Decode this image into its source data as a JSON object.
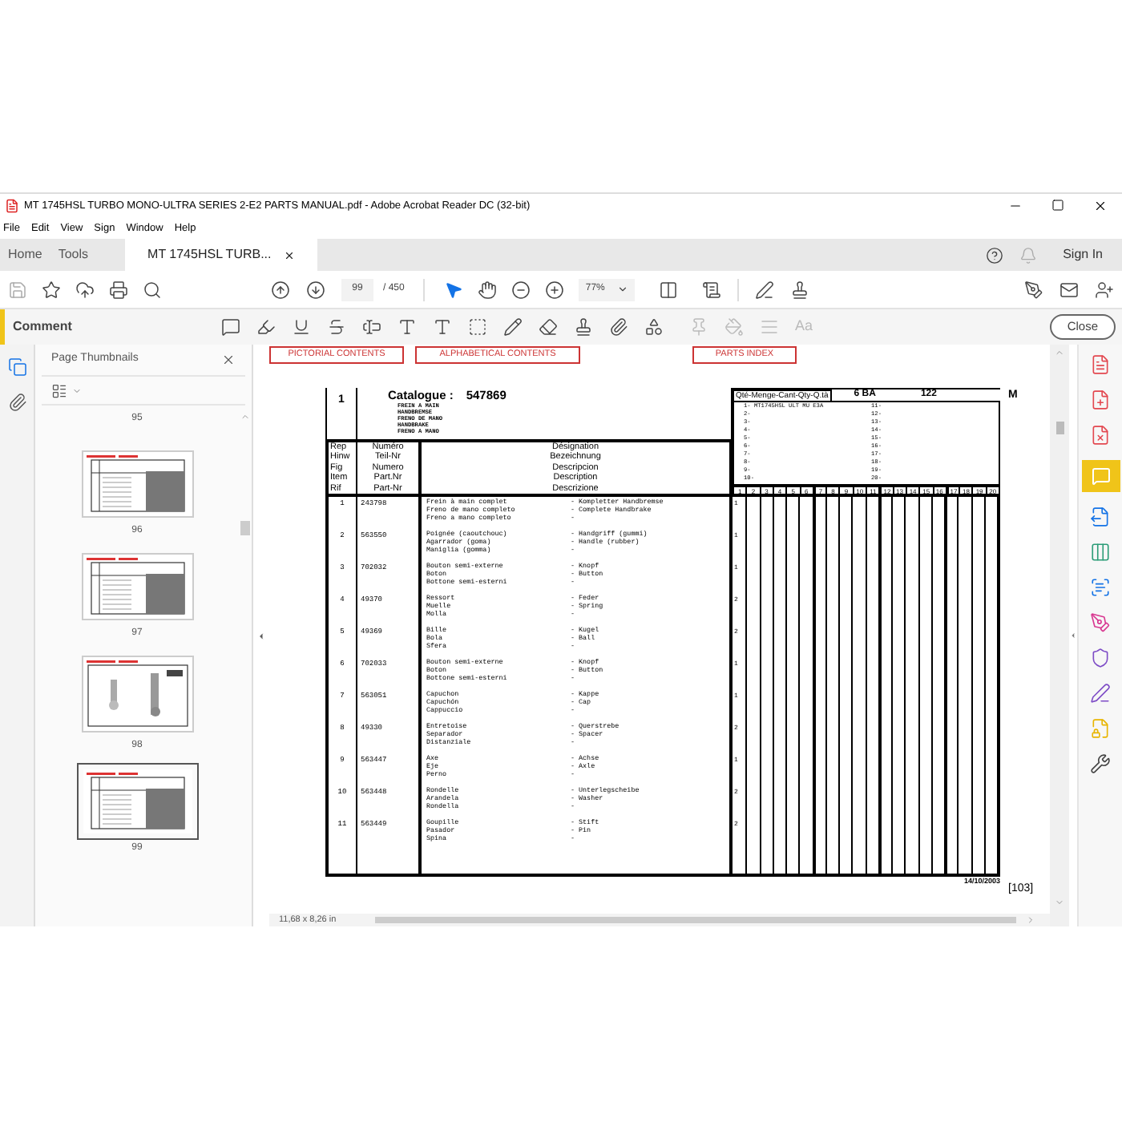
{
  "window": {
    "title": "MT 1745HSL TURBO MONO-ULTRA SERIES 2-E2 PARTS MANUAL.pdf - Adobe Acrobat Reader DC (32-bit)"
  },
  "menu": [
    "File",
    "Edit",
    "View",
    "Sign",
    "Window",
    "Help"
  ],
  "tabs": [
    {
      "label": "Home",
      "selected": false
    },
    {
      "label": "Tools",
      "selected": false
    },
    {
      "label": "MT 1745HSL TURB...",
      "selected": true
    }
  ],
  "sign_in": "Sign In",
  "toolbar": {
    "page": "99",
    "page_count": "/ 450",
    "zoom": "77%"
  },
  "comment_bar": {
    "label": "Comment",
    "font_tool": "Aa",
    "close": "Close"
  },
  "thumbnails": {
    "title": "Page Thumbnails",
    "first_label": "95",
    "pages": [
      {
        "label": "96",
        "kind": "table",
        "selected": false
      },
      {
        "label": "97",
        "kind": "table",
        "selected": false
      },
      {
        "label": "98",
        "kind": "diagram",
        "selected": false
      },
      {
        "label": "99",
        "kind": "table",
        "selected": true
      }
    ]
  },
  "document": {
    "links": [
      "PICTORIAL CONTENTS",
      "ALPHABETICAL CONTENTS",
      "PARTS INDEX"
    ],
    "group": "1",
    "catalogue_label": "Catalogue :",
    "catalogue_number": "547869",
    "titles": [
      "FREIN A MAIN",
      "HANDBREMSE",
      "FRENO DE MANO",
      "HANDBRAKE",
      "FRENO A MANO"
    ],
    "qty_header": "Qté-Menge-Cant-Qty-Q.tà",
    "code": "6 BA",
    "number": "122",
    "mark": "M",
    "models": [
      "1- MT1745HSL ULT MU E3A",
      "2-",
      "3-",
      "4-",
      "5-",
      "6-",
      "7-",
      "8-",
      "9-",
      "10-",
      "11-",
      "12-",
      "13-",
      "14-",
      "15-",
      "16-",
      "17-",
      "18-",
      "19-",
      "20-"
    ],
    "head_rep": [
      "Rep",
      "Hinw",
      "Fig",
      "Item",
      "Rif"
    ],
    "head_number": [
      "Numéro",
      "Teil-Nr",
      "Numero",
      "Part.Nr",
      "Part-Nr"
    ],
    "head_designation": [
      "Désignation",
      "Bezeichnung",
      "Descripcion",
      "Description",
      "Descrizione"
    ],
    "columns": [
      "1",
      "2",
      "3",
      "4",
      "5",
      "6",
      "7",
      "8",
      "9",
      "10",
      "11",
      "12",
      "13",
      "14",
      "15",
      "16",
      "17",
      "18",
      "19",
      "20"
    ],
    "rows": [
      {
        "item": "1",
        "part": "243798",
        "names": [
          "Frein à main complet",
          "Freno de mano completo",
          "Freno a mano completo"
        ],
        "translations": [
          "- Kompletter Handbremse",
          "- Complete Handbrake",
          "-"
        ],
        "qty": "1"
      },
      {
        "item": "2",
        "part": "563550",
        "names": [
          "Poignée (caoutchouc)",
          "Agarrador (goma)",
          "Maniglia (gomma)"
        ],
        "translations": [
          "- Handgriff (gummi)",
          "- Handle (rubber)",
          "-"
        ],
        "qty": "1"
      },
      {
        "item": "3",
        "part": "702032",
        "names": [
          "Bouton semi-externe",
          "Boton",
          "Bottone semi-esterni"
        ],
        "translations": [
          "- Knopf",
          "- Button",
          "-"
        ],
        "qty": "1"
      },
      {
        "item": "4",
        "part": "49370",
        "names": [
          "Ressort",
          "Muelle",
          "Molla"
        ],
        "translations": [
          "- Feder",
          "- Spring",
          "-"
        ],
        "qty": "2"
      },
      {
        "item": "5",
        "part": "49369",
        "names": [
          "Bille",
          "Bola",
          "Sfera"
        ],
        "translations": [
          "- Kugel",
          "- Ball",
          "-"
        ],
        "qty": "2"
      },
      {
        "item": "6",
        "part": "702033",
        "names": [
          "Bouton semi-externe",
          "Boton",
          "Bottone semi-esterni"
        ],
        "translations": [
          "- Knopf",
          "- Button",
          "-"
        ],
        "qty": "1"
      },
      {
        "item": "7",
        "part": "563051",
        "names": [
          "Capuchon",
          "Capuchón",
          "Cappuccio"
        ],
        "translations": [
          "- Kappe",
          "- Cap",
          "-"
        ],
        "qty": "1"
      },
      {
        "item": "8",
        "part": "49330",
        "names": [
          "Entretoise",
          "Separador",
          "Distanziale"
        ],
        "translations": [
          "- Querstrebe",
          "- Spacer",
          "-"
        ],
        "qty": "2"
      },
      {
        "item": "9",
        "part": "563447",
        "names": [
          "Axe",
          "Eje",
          "Perno"
        ],
        "translations": [
          "- Achse",
          "- Axle",
          "-"
        ],
        "qty": "1"
      },
      {
        "item": "10",
        "part": "563448",
        "names": [
          "Rondelle",
          "Arandela",
          "Rondella"
        ],
        "translations": [
          "- Unterlegscheibe",
          "- Washer",
          "-"
        ],
        "qty": "2"
      },
      {
        "item": "11",
        "part": "563449",
        "names": [
          "Goupille",
          "Pasador",
          "Spina"
        ],
        "translations": [
          "- Stift",
          "- Pin",
          "-"
        ],
        "qty": "2"
      }
    ],
    "date": "14/10/2003",
    "page_label": "[103]"
  },
  "status": {
    "page_size": "11,68 x 8,26 in"
  }
}
